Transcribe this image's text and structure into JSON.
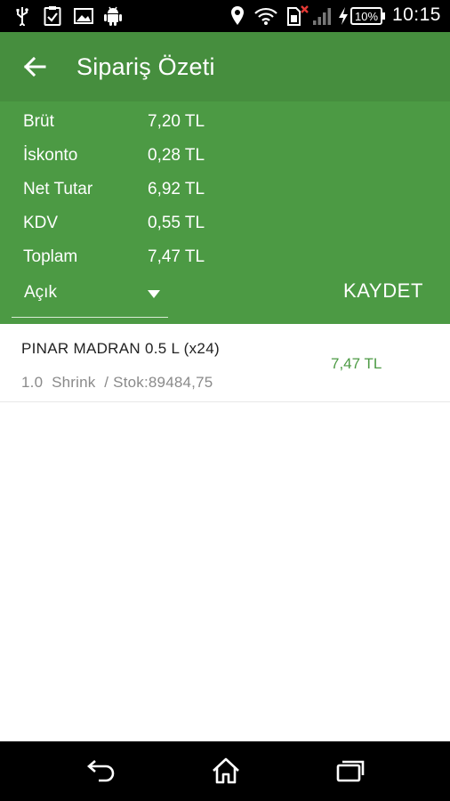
{
  "status_bar": {
    "time": "10:15",
    "battery": "10%",
    "icons": [
      "usb-icon",
      "check-icon",
      "image-icon",
      "android-icon",
      "location-icon",
      "wifi-icon",
      "sim-icon",
      "signal-icon",
      "charging-icon",
      "battery-icon"
    ]
  },
  "app_bar": {
    "title": "Sipariş Özeti",
    "back_icon": "arrow-left-icon"
  },
  "summary": {
    "rows": [
      {
        "label": "Brüt",
        "value": "7,20 TL"
      },
      {
        "label": "İskonto",
        "value": "0,28 TL"
      },
      {
        "label": "Net Tutar",
        "value": "6,92 TL"
      },
      {
        "label": "KDV",
        "value": "0,55 TL"
      },
      {
        "label": "Toplam",
        "value": "7,47 TL"
      }
    ],
    "status_select": {
      "selected": "Açık"
    },
    "save_label": "KAYDET"
  },
  "items": [
    {
      "name": "PINAR MADRAN 0.5 L (x24)",
      "detail": "1.0  Shrink  / Stok:89484,75",
      "price": "7,47 TL"
    }
  ],
  "colors": {
    "app_bar": "#468e3e",
    "summary_bg": "#4c9a44",
    "price_text": "#4c9a44"
  },
  "nav_bar": {
    "buttons": [
      "back-icon",
      "home-icon",
      "recents-icon"
    ]
  }
}
